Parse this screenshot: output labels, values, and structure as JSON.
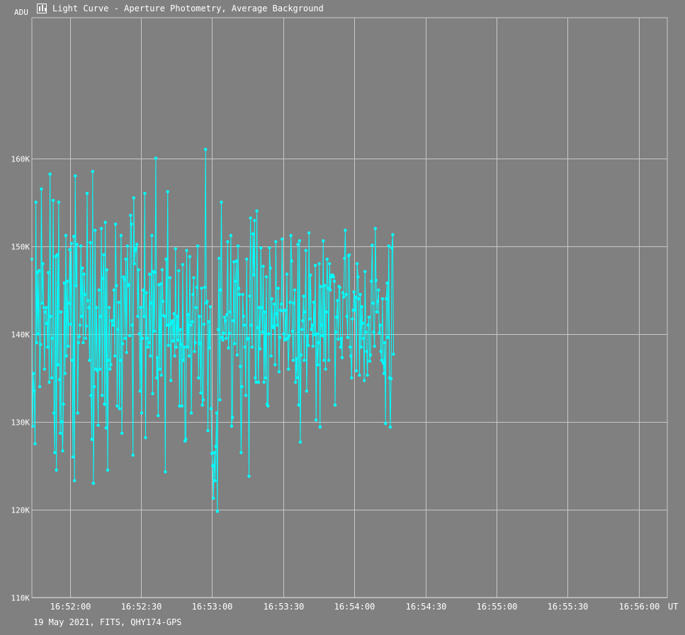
{
  "header": {
    "icon": "light-curve-icon",
    "title": "Light Curve - Aperture Photometry, Average Background"
  },
  "footer": {
    "text": "19 May 2021, FITS, QHY174-GPS"
  },
  "colors": {
    "background": "#808080",
    "grid": "#c8c8c8",
    "series": "#00ffff",
    "text": "#ffffff"
  },
  "chart_data": {
    "type": "line",
    "title": "Light Curve - Aperture Photometry, Average Background",
    "ylabel": "ADU",
    "xlabel": "UT",
    "x_unit": "UT",
    "ylim": [
      110000,
      176000
    ],
    "xlim": [
      "16:51:44",
      "16:56:12"
    ],
    "grid": true,
    "legend": "none",
    "x_ticks": [
      "16:52:00",
      "16:52:30",
      "16:53:00",
      "16:53:30",
      "16:54:00",
      "16:54:30",
      "16:55:00",
      "16:55:30",
      "16:56:00"
    ],
    "y_ticks": [
      {
        "value": 110000,
        "label": "110K"
      },
      {
        "value": 120000,
        "label": "120K"
      },
      {
        "value": 130000,
        "label": "130K"
      },
      {
        "value": 140000,
        "label": "140K"
      },
      {
        "value": 150000,
        "label": "150K"
      },
      {
        "value": 160000,
        "label": "160K"
      }
    ],
    "series": [
      {
        "marker": "circle",
        "sampling_note": "approx. 3 samples per second; values estimated from gridlines",
        "x_start": "16:51:44.0",
        "x_step_seconds": 0.333,
        "values": [
          148500,
          129500,
          135500,
          133500,
          127500,
          155000,
          139000,
          147000,
          140000,
          147200,
          134000,
          138800,
          156500,
          143500,
          148000,
          143000,
          136000,
          142500,
          143000,
          141200,
          138500,
          147000,
          134500,
          158200,
          142000,
          135000,
          139500,
          155200,
          131000,
          126500,
          148800,
          124500,
          149000,
          136500,
          155000,
          134800,
          128700,
          142500,
          130000,
          126700,
          132000,
          145800,
          135500,
          151200,
          137500,
          146000,
          138600,
          143500,
          149600,
          141100,
          150300,
          137000,
          126000,
          151100,
          123300,
          158000,
          145500,
          150200,
          131000,
          139000,
          139700,
          141000,
          150000,
          142000,
          147500,
          139000,
          146800,
          144500,
          139500,
          140900,
          156000,
          143800,
          143000,
          137000,
          150400,
          133000,
          128000,
          158500,
          123000,
          134000,
          151800,
          136000,
          143000,
          135800,
          129600,
          145000,
          136000,
          142000,
          152000,
          133000,
          146300,
          149000,
          132000,
          152700,
          129300,
          147300,
          124500,
          137000,
          143000,
          136000,
          136500,
          141500,
          141500,
          141000,
          145000,
          137500,
          152500,
          145500,
          131800,
          140500,
          143600,
          131500,
          137000,
          151200,
          128700,
          138900,
          146500,
          146200,
          139500,
          148500,
          137900,
          150000,
          145500,
          145600,
          139800,
          153500,
          152500,
          141000,
          126200,
          155500,
          148000,
          149500,
          149800,
          150200,
          142000,
          147300,
          140000,
          133500,
          143000,
          131000,
          139500,
          145000,
          142000,
          156000,
          128200,
          144700,
          139500,
          138500,
          139000,
          146800,
          137500,
          143500,
          151200,
          133200,
          147100,
          140300,
          147000,
          160000,
          135000,
          137300,
          130700,
          145600,
          136000,
          145700,
          135300,
          147300,
          143700,
          142100,
          142000,
          124300,
          148500,
          141000,
          156200,
          138700,
          141000,
          146400,
          134700,
          141200,
          141500,
          139200,
          142300,
          137500,
          149700,
          138500,
          142000,
          139300,
          147200,
          131800,
          140500,
          138800,
          131800,
          147900,
          137000,
          138500,
          127800,
          128000,
          149500,
          138500,
          142200,
          137500,
          148800,
          141000,
          131000,
          141400,
          144500,
          146400,
          138000,
          139000,
          143000,
          145300,
          150000,
          135000,
          142000,
          138900,
          133300,
          145200,
          131900,
          132500,
          141100,
          145300,
          161000,
          143500,
          143700,
          129000,
          141400,
          138400,
          143100,
          131500,
          126400,
          125000,
          121300,
          126500,
          123300,
          127200,
          131000,
          119800,
          140500,
          148600,
          132500,
          145000,
          155000,
          139600,
          139300,
          140100,
          141900,
          141500,
          139500,
          142200,
          150500,
          138400,
          140100,
          142500,
          151200,
          129500,
          130500,
          141500,
          148200,
          138900,
          146000,
          148300,
          137600,
          150000,
          145200,
          144500,
          136300,
          126500,
          134000,
          144500,
          142000,
          141000,
          138500,
          133000,
          148500,
          139400,
          139500,
          123800,
          144300,
          153200,
          141000,
          138500,
          151400,
          146700,
          152900,
          135000,
          134500,
          154000,
          140700,
          134500,
          143000,
          138300,
          149800,
          143000,
          140200,
          147700,
          134500,
          142500,
          135000,
          146500,
          132000,
          131800,
          140000,
          149800,
          147500,
          137500,
          144000,
          140900,
          140700,
          143400,
          136500,
          150500,
          142300,
          141000,
          145200,
          135700,
          139600,
          142700,
          143400,
          150800,
          142600,
          140000,
          139300,
          142700,
          139400,
          146800,
          139500,
          136000,
          139800,
          143600,
          151200,
          148300,
          140300,
          137000,
          143500,
          145000,
          134500,
          137200,
          135000,
          150200,
          131900,
          150600,
          127700,
          137600,
          140500,
          141500,
          144300,
          137000,
          142500,
          149500,
          133500,
          139800,
          138700,
          151500,
          141700,
          146700,
          140500,
          141000,
          138600,
          143600,
          139900,
          147800,
          130200,
          140000,
          136500,
          139000,
          148000,
          129400,
          145400,
          141000,
          139800,
          150600,
          137000,
          145500,
          136000,
          142500,
          148500,
          145200,
          137000,
          148000,
          145000,
          146500,
          146700,
          146700,
          146500,
          146000,
          131900,
          140200,
          141900,
          143800,
          139400,
          145400,
          145300,
          138500,
          139500,
          137300,
          144700,
          144200,
          148600,
          151800,
          144500,
          142000,
          139600,
          148900,
          149000,
          138500,
          137500,
          135000,
          141700,
          142700,
          144800,
          142700,
          144200,
          135800,
          148000,
          146500,
          144000,
          135300,
          144500,
          138500,
          143100,
          141200,
          139500,
          134700,
          147100,
          140200,
          138000,
          135300,
          141000,
          141900,
          136900,
          137600,
          146000,
          150100,
          143500,
          140200,
          138600,
          152000,
          146100,
          142500,
          143700,
          145000,
          140100,
          141000,
          138000,
          137000,
          144000,
          136700,
          135500,
          139000,
          129800,
          144000,
          145800,
          139600,
          150000,
          135000,
          129400,
          134900,
          149800,
          151300,
          137700
        ]
      }
    ]
  }
}
